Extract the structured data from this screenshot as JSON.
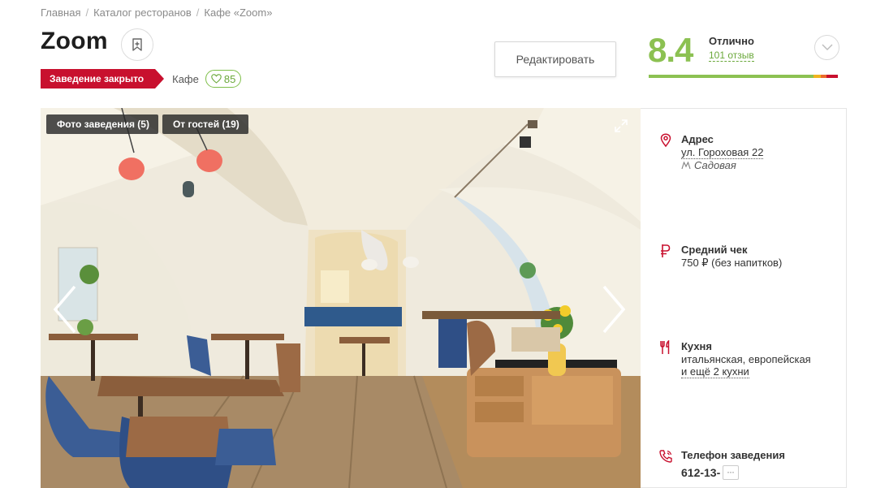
{
  "breadcrumb": [
    {
      "label": "Главная"
    },
    {
      "label": "Каталог ресторанов"
    },
    {
      "label": "Кафе «Zoom»"
    }
  ],
  "breadcrumb_separator": "/",
  "title": "Zoom",
  "status_badge": "Заведение закрыто",
  "venue_type": "Кафе",
  "likes_count": "85",
  "edit_button": "Редактировать",
  "rating": {
    "score": "8.4",
    "word": "Отлично",
    "reviews": "101 отзыв",
    "distribution": {
      "excellent": 0.87,
      "good": 0.04,
      "average": 0.03,
      "bad": 0.06
    },
    "colors": {
      "excellent": "#8cc152",
      "good": "#f0b41e",
      "average": "#ea6a2b",
      "bad": "#c8102e"
    }
  },
  "gallery": {
    "tabs": [
      {
        "label": "Фото заведения (5)"
      },
      {
        "label": "От гостей (19)"
      }
    ],
    "icons": {
      "expand": "expand-icon",
      "prev": "chevron-left-icon",
      "next": "chevron-right-icon"
    }
  },
  "info": {
    "address": {
      "label": "Адрес",
      "street": "ул. Гороховая 22",
      "metro": "Садовая",
      "icon": "location-pin-icon"
    },
    "avg_check": {
      "label": "Средний чек",
      "value": "750 ₽ (без напитков)",
      "icon": "ruble-icon"
    },
    "cuisine": {
      "label": "Кухня",
      "value": "итальянская, европейская",
      "more": "и ещё 2 кухни",
      "icon": "fork-knife-icon"
    },
    "phone": {
      "label": "Телефон заведения",
      "value": "612-13-",
      "more": "···",
      "icon": "phone-icon"
    }
  },
  "colors": {
    "brand_red": "#c8102e",
    "rating_green": "#8cc152",
    "link_green": "#6aa83a"
  }
}
